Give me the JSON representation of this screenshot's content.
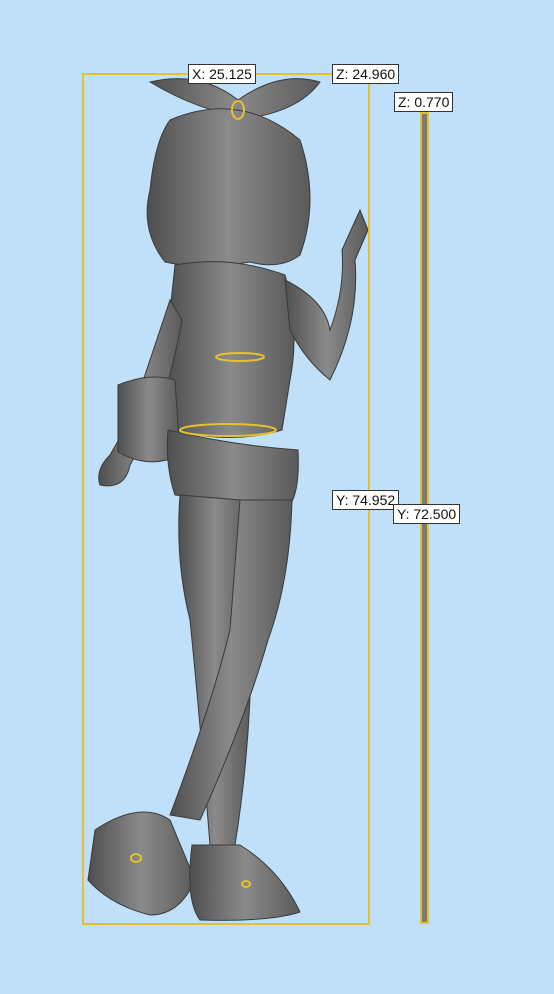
{
  "viewport": {
    "background": "#bfe0f8",
    "accent": "#e6c12c",
    "model_color": "#6d6d6d"
  },
  "main_model": {
    "label_x": "X: 25.125",
    "label_z": "Z: 24.960",
    "label_y": "Y: 74.952"
  },
  "thin_model": {
    "label_z": "Z: 0.770",
    "label_y": "Y: 72.500"
  }
}
